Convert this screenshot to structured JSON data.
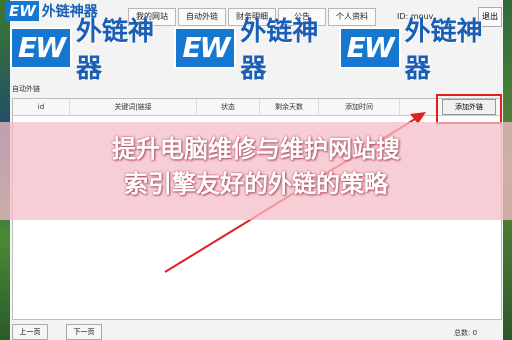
{
  "brand": {
    "mark": "EW",
    "name": "外链神器"
  },
  "tabs": [
    "我的网站",
    "自动外链",
    "财务明细",
    "公告",
    "个人资料"
  ],
  "user_id": "ID: mouv",
  "exit_label": "退出",
  "group_label": "自动外链",
  "columns": [
    "id",
    "关键词|链接",
    "状态",
    "剩余天数",
    "添加时间"
  ],
  "add_button": "添加外链",
  "headline": [
    "提升电脑维修与维护网站搜",
    "索引擎友好的外链的策略"
  ],
  "footer": {
    "prev": "上一页",
    "next": "下一页",
    "total": "总数: 0"
  },
  "colors": {
    "brand_blue": "#1577d0",
    "highlight_red": "#e02020",
    "overlay_pink": "#f6bec8"
  }
}
